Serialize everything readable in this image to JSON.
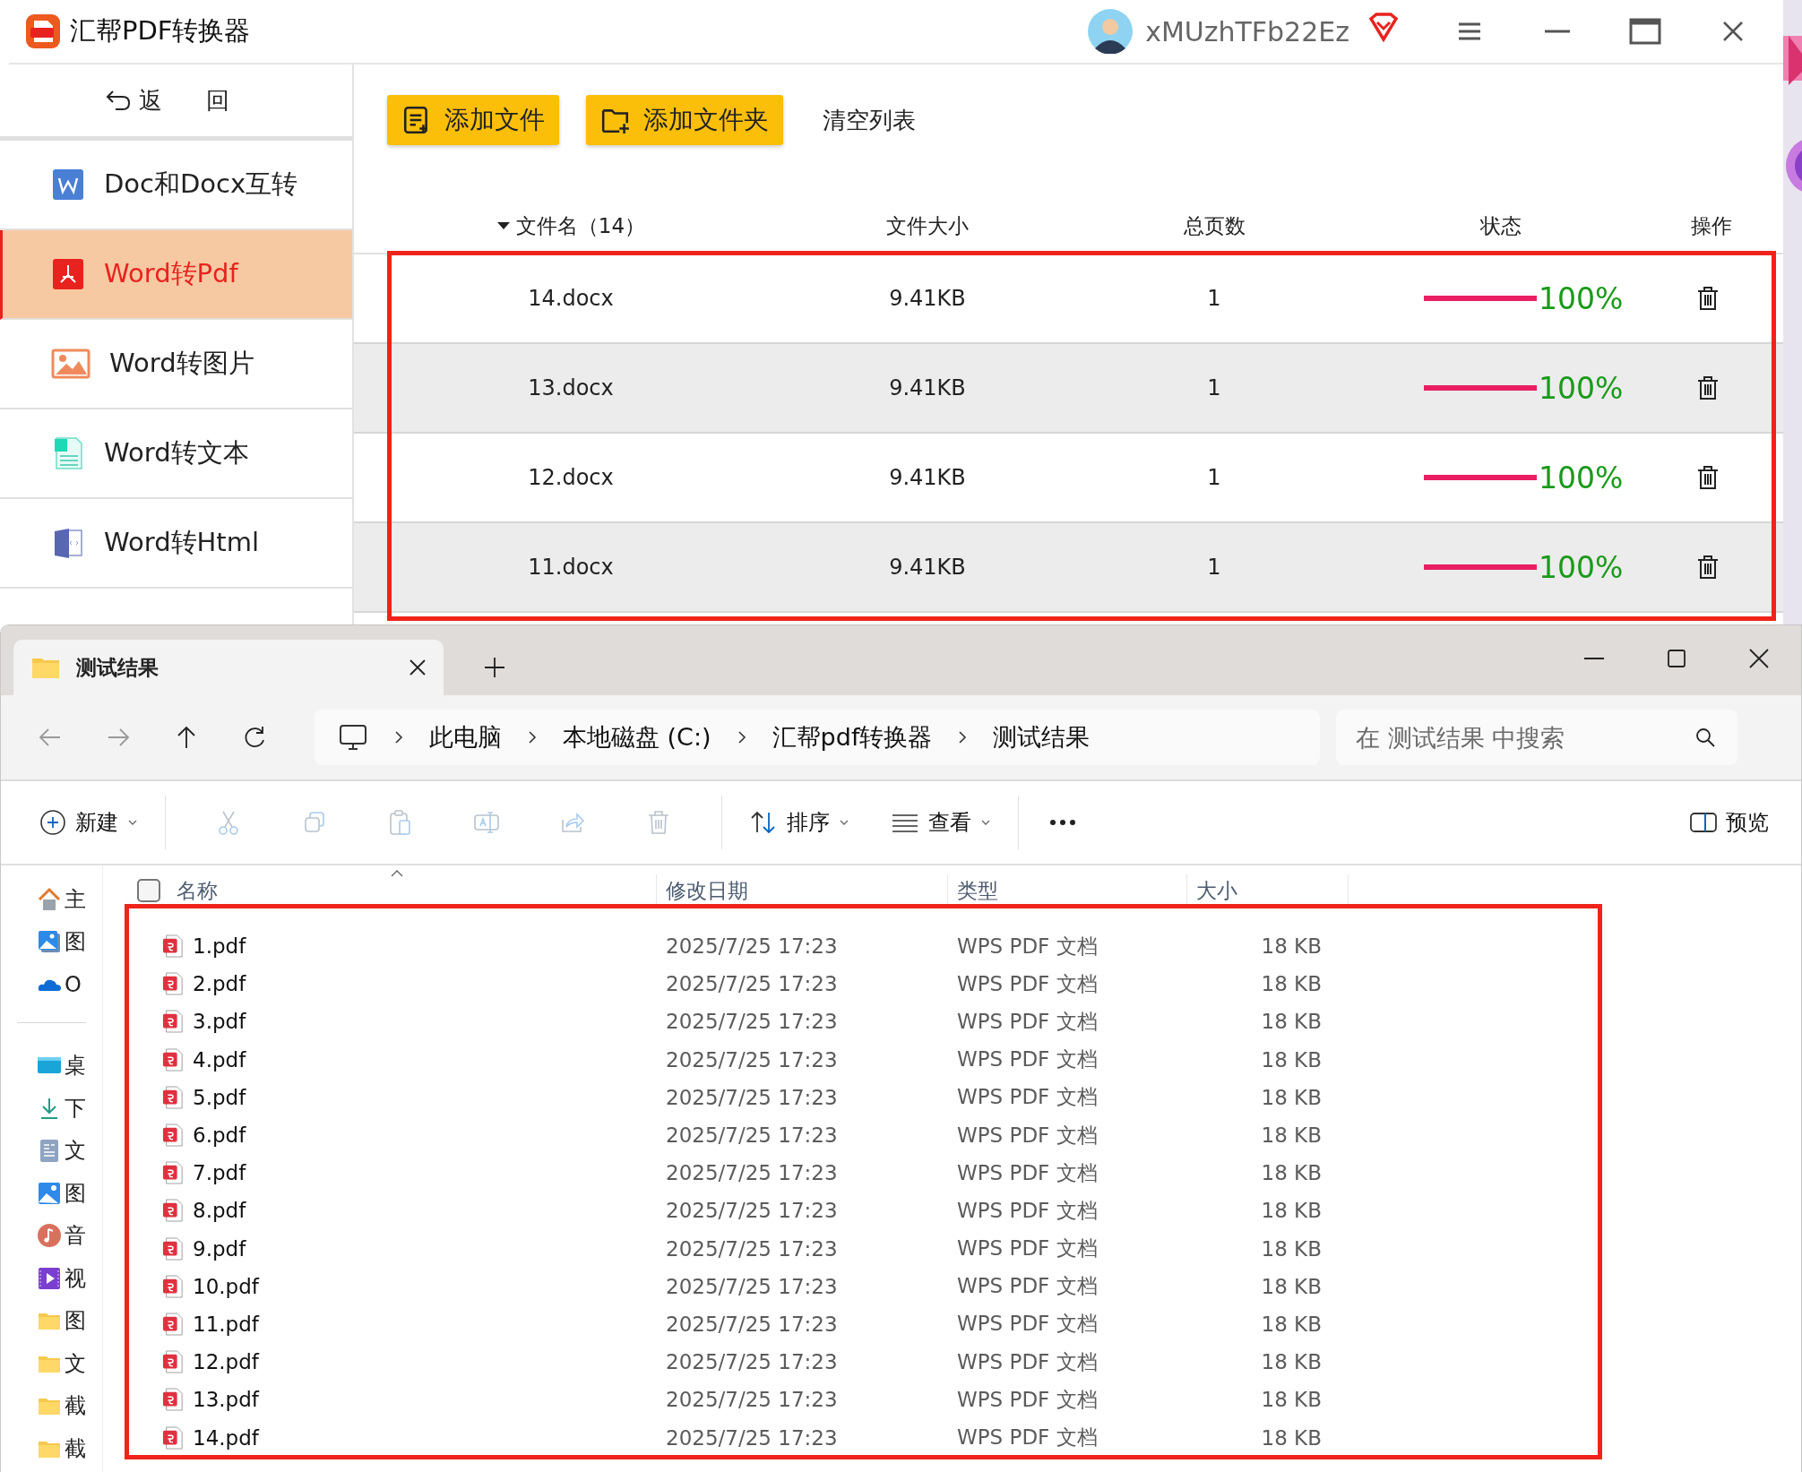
{
  "converter": {
    "title": "汇帮PDF转换器",
    "user": "xMUzhTFb22Ez",
    "back": "返 回",
    "sidebar": {
      "items": [
        {
          "label": "Doc和Docx互转",
          "kind": "doc",
          "selected": false
        },
        {
          "label": "Word转Pdf",
          "kind": "pdf",
          "selected": true
        },
        {
          "label": "Word转图片",
          "kind": "image",
          "selected": false
        },
        {
          "label": "Word转文本",
          "kind": "text",
          "selected": false
        },
        {
          "label": "Word转Html",
          "kind": "html",
          "selected": false
        }
      ]
    },
    "toolbar": {
      "buttons": [
        {
          "label": "添加文件",
          "kind": "file"
        },
        {
          "label": "添加文件夹",
          "kind": "folder"
        }
      ],
      "clear": "清空列表"
    },
    "table": {
      "columns": [
        "文件名（14）",
        "文件大小",
        "总页数",
        "状态",
        "操作"
      ],
      "rows": [
        {
          "name": "14.docx",
          "size": "9.41KB",
          "pages": "1",
          "level": 1,
          "progress": "100%"
        },
        {
          "name": "13.docx",
          "size": "9.41KB",
          "pages": "1",
          "level": 1,
          "progress": "100%"
        },
        {
          "name": "12.docx",
          "size": "9.41KB",
          "pages": "1",
          "level": 1,
          "progress": "100%"
        },
        {
          "name": "11.docx",
          "size": "9.41KB",
          "pages": "1",
          "level": 1,
          "progress": "100%"
        }
      ]
    }
  },
  "explorer": {
    "tab": "测试结果",
    "breadcrumb": [
      "此电脑",
      "本地磁盘 (C:)",
      "汇帮pdf转换器",
      "测试结果"
    ],
    "search": {
      "placeholder": "在 测试结果 中搜索"
    },
    "toolbar": {
      "new": "新建",
      "actions": [
        {
          "kind": "cut",
          "disabled": true
        },
        {
          "kind": "copy",
          "disabled": true
        },
        {
          "kind": "paste",
          "disabled": true
        },
        {
          "kind": "rename",
          "disabled": true
        },
        {
          "kind": "share",
          "disabled": true
        },
        {
          "kind": "delete",
          "disabled": true
        }
      ],
      "sort": "排序",
      "view": "查看",
      "preview": "预览"
    },
    "nav": {
      "quick": [
        {
          "label": "主",
          "kind": "home"
        },
        {
          "label": "图",
          "kind": "gallery"
        },
        {
          "label": "O",
          "kind": "cloud"
        }
      ],
      "places": [
        {
          "label": "桌",
          "kind": "desktop"
        },
        {
          "label": "下",
          "kind": "download"
        },
        {
          "label": "文",
          "kind": "docs"
        },
        {
          "label": "图",
          "kind": "pictures"
        },
        {
          "label": "音",
          "kind": "music"
        },
        {
          "label": "视",
          "kind": "video"
        },
        {
          "label": "图",
          "kind": "folder"
        },
        {
          "label": "文",
          "kind": "folder"
        },
        {
          "label": "截",
          "kind": "folder"
        },
        {
          "label": "截",
          "kind": "folder"
        }
      ]
    },
    "select_all": {
      "checked": false
    },
    "columns": [
      "名称",
      "修改日期",
      "类型",
      "大小"
    ],
    "files": [
      {
        "name": "1.pdf",
        "modified": "2025/7/25 17:23",
        "type": "WPS PDF 文档",
        "size": "18 KB"
      },
      {
        "name": "2.pdf",
        "modified": "2025/7/25 17:23",
        "type": "WPS PDF 文档",
        "size": "18 KB"
      },
      {
        "name": "3.pdf",
        "modified": "2025/7/25 17:23",
        "type": "WPS PDF 文档",
        "size": "18 KB"
      },
      {
        "name": "4.pdf",
        "modified": "2025/7/25 17:23",
        "type": "WPS PDF 文档",
        "size": "18 KB"
      },
      {
        "name": "5.pdf",
        "modified": "2025/7/25 17:23",
        "type": "WPS PDF 文档",
        "size": "18 KB"
      },
      {
        "name": "6.pdf",
        "modified": "2025/7/25 17:23",
        "type": "WPS PDF 文档",
        "size": "18 KB"
      },
      {
        "name": "7.pdf",
        "modified": "2025/7/25 17:23",
        "type": "WPS PDF 文档",
        "size": "18 KB"
      },
      {
        "name": "8.pdf",
        "modified": "2025/7/25 17:23",
        "type": "WPS PDF 文档",
        "size": "18 KB"
      },
      {
        "name": "9.pdf",
        "modified": "2025/7/25 17:23",
        "type": "WPS PDF 文档",
        "size": "18 KB"
      },
      {
        "name": "10.pdf",
        "modified": "2025/7/25 17:23",
        "type": "WPS PDF 文档",
        "size": "18 KB"
      },
      {
        "name": "11.pdf",
        "modified": "2025/7/25 17:23",
        "type": "WPS PDF 文档",
        "size": "18 KB"
      },
      {
        "name": "12.pdf",
        "modified": "2025/7/25 17:23",
        "type": "WPS PDF 文档",
        "size": "18 KB"
      },
      {
        "name": "13.pdf",
        "modified": "2025/7/25 17:23",
        "type": "WPS PDF 文档",
        "size": "18 KB"
      },
      {
        "name": "14.pdf",
        "modified": "2025/7/25 17:23",
        "type": "WPS PDF 文档",
        "size": "18 KB"
      }
    ]
  }
}
